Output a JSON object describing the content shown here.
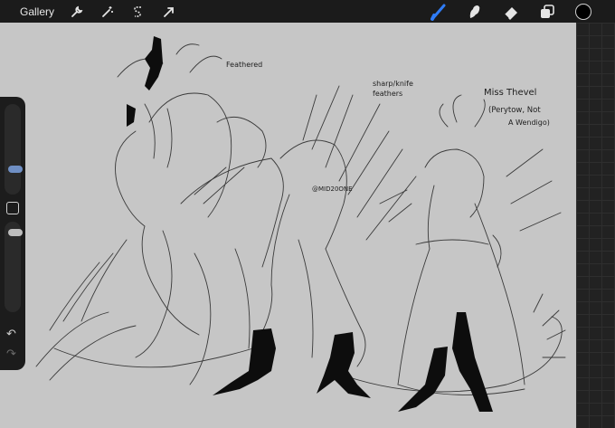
{
  "toolbar": {
    "gallery_label": "Gallery",
    "left_tools": [
      "wrench-icon",
      "magic-wand-icon",
      "selection-icon",
      "transform-arrow-icon"
    ],
    "right_tools": [
      "brush-icon",
      "smudge-icon",
      "eraser-icon",
      "layers-icon"
    ],
    "active_tool_color": "#2f7cf6",
    "current_color": "#000000"
  },
  "sidebar": {
    "brush_size_level": 0.42,
    "opacity_level": 0.85,
    "undo_icon": "↶",
    "redo_icon": "↷"
  },
  "canvas": {
    "background": "#c6c6c6",
    "notes": {
      "feathered": "Feathered",
      "sharp_feathers": "sharp/knife\nfeathers",
      "title_line1": "Miss Thevel",
      "title_line2": "(Perytow, Not",
      "title_line3": "A Wendigo)",
      "handle": "@MID20ONE"
    }
  }
}
